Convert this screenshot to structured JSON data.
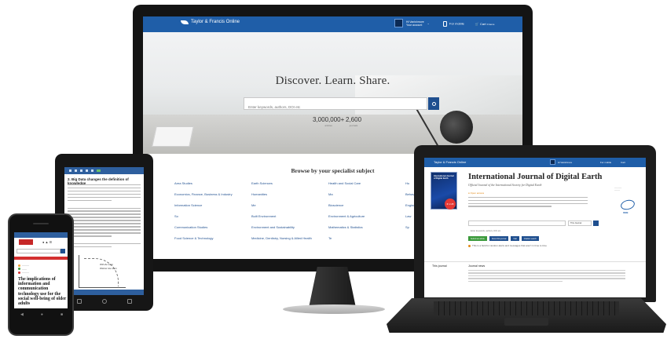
{
  "monitor": {
    "brand": "Taylor & Francis Online",
    "account_name": "Hi Vanishmore",
    "account_sub": "Your account",
    "for_mobile": "For mobile",
    "cart": "Cart",
    "cart_count": "0 items",
    "headline": "Discover. Learn. Share.",
    "search_placeholder": "Enter keywords, authors, DOI etc",
    "stats": [
      {
        "num": "3,000,000+",
        "label": "articles"
      },
      {
        "num": "2,600",
        "label": "journals"
      }
    ],
    "browse_title": "Browse by your specialist subject",
    "subjects": [
      "Area Studies",
      "Earth Sciences",
      "Health and Social Care",
      "Hu",
      "Arts",
      "Economics, Finance, Business & Industry",
      "Humanities",
      "Ma",
      "Behavioral Sciences",
      "Education",
      "Information Science",
      "Me",
      "Bioscience",
      "Engineering & Technology",
      "Language & Literature",
      "So",
      "Built Environment",
      "Environment & Agriculture",
      "Law",
      "Sp",
      "Communication Studies",
      "Environment and Sustainability",
      "Mathematics & Statistics",
      "Sp",
      "Computer Science",
      "Food Science & Technology",
      "Medicine, Dentistry, Nursing & Allied Health",
      "Te"
    ]
  },
  "tablet": {
    "article_title": "2. Big Data changes the definition of knowledge",
    "chart_label_1": "Will die soon",
    "chart_label_2": "Widow' die soon"
  },
  "phone": {
    "article_title": "The implications of information and communication technology use for the social well-being of older adults"
  },
  "laptop": {
    "brand": "Taylor & Francis Online",
    "account_name": "Hi Vanishmore",
    "for_mobile": "For mobile",
    "cart": "Cart",
    "cover_title": "International Journal of Digital Earth",
    "impact_factor": "IF 2.28",
    "journal_title": "International Journal of Digital Earth",
    "journal_sub": "Official Journal of the International Society for Digital Earth",
    "open_access": "Open access",
    "search_placeholder": "Enter keywords, authors, DOI etc",
    "search_scope": "This Journal",
    "buttons": [
      "Submit an article",
      "About this journal",
      "Visit",
      "Citation search"
    ],
    "notice": "This is a field for random alerts and messages that aren't in time to time",
    "logo_label": "ISDE",
    "tab_journal": "This journal",
    "tab_news": "Journal news"
  }
}
